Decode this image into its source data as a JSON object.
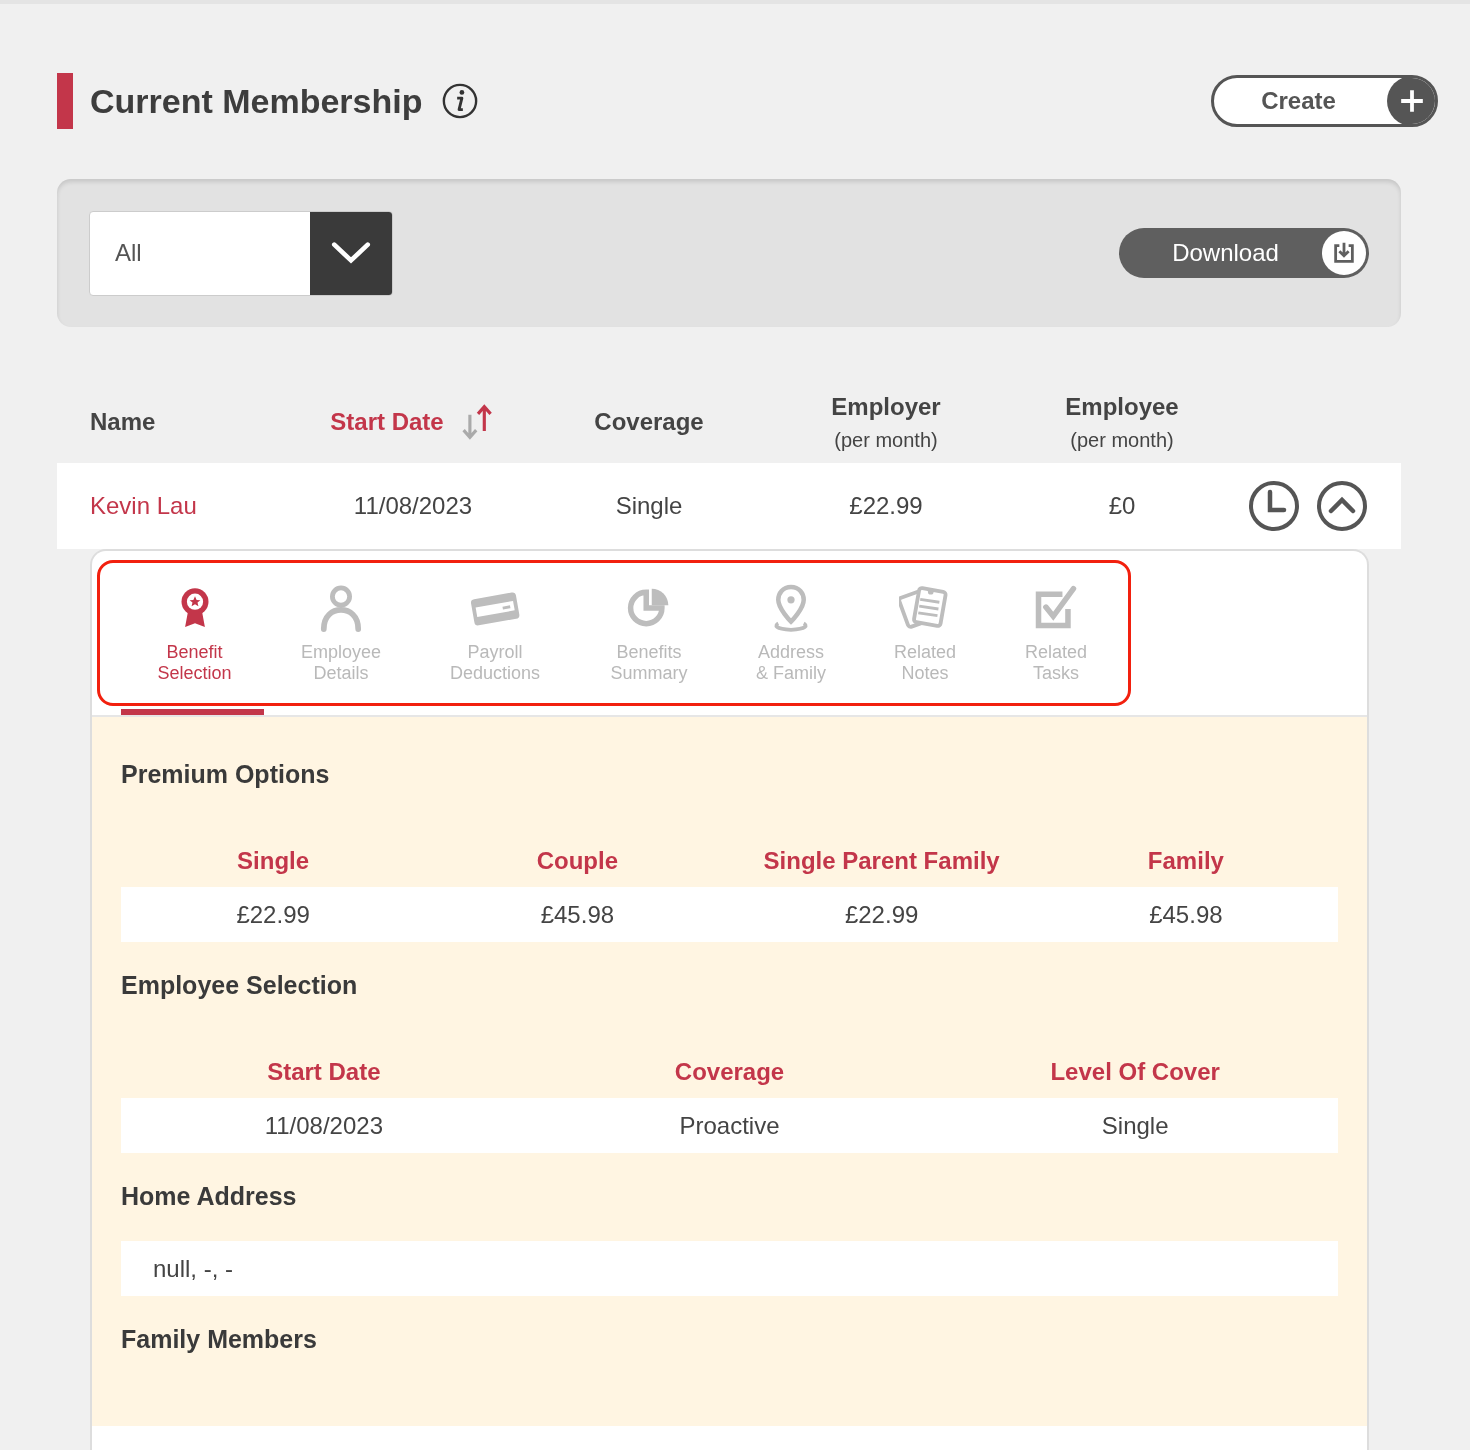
{
  "header": {
    "title": "Current Membership",
    "create_label": "Create"
  },
  "filter": {
    "value": "All",
    "download_label": "Download"
  },
  "table": {
    "columns": [
      {
        "label": "Name",
        "sorted": false
      },
      {
        "label": "Start Date",
        "sorted": true
      },
      {
        "label": "Coverage",
        "sorted": false
      },
      {
        "label": "Employer",
        "sublabel": "(per month)",
        "sorted": false
      },
      {
        "label": "Employee",
        "sublabel": "(per month)",
        "sorted": false
      }
    ],
    "rows": [
      {
        "cells": [
          "Kevin Lau",
          "11/08/2023",
          "Single",
          "£22.99",
          "£0"
        ],
        "expanded": true
      }
    ]
  },
  "details": {
    "tabs": [
      {
        "label": "Benefit\nSelection",
        "selected": true
      },
      {
        "label": "Employee\nDetails",
        "selected": false
      },
      {
        "label": "Payroll\nDeductions",
        "selected": false
      },
      {
        "label": "Benefits\nSummary",
        "selected": false
      },
      {
        "label": "Address\n& Family",
        "selected": false
      },
      {
        "label": "Related\nNotes",
        "selected": false
      },
      {
        "label": "Related\nTasks",
        "selected": false
      }
    ],
    "sections": [
      {
        "kind": "table",
        "title": "Premium Options",
        "columns": [
          "Single",
          "Couple",
          "Single Parent Family",
          "Family"
        ],
        "values": [
          "£22.99",
          "£45.98",
          "£22.99",
          "£45.98"
        ]
      },
      {
        "kind": "table",
        "title": "Employee Selection",
        "columns": [
          "Start Date",
          "Coverage",
          "Level Of Cover"
        ],
        "values": [
          "11/08/2023",
          "Proactive",
          "Single"
        ]
      },
      {
        "kind": "text",
        "title": "Home Address",
        "value": "null, -, -"
      },
      {
        "kind": "heading",
        "title": "Family Members"
      }
    ]
  }
}
